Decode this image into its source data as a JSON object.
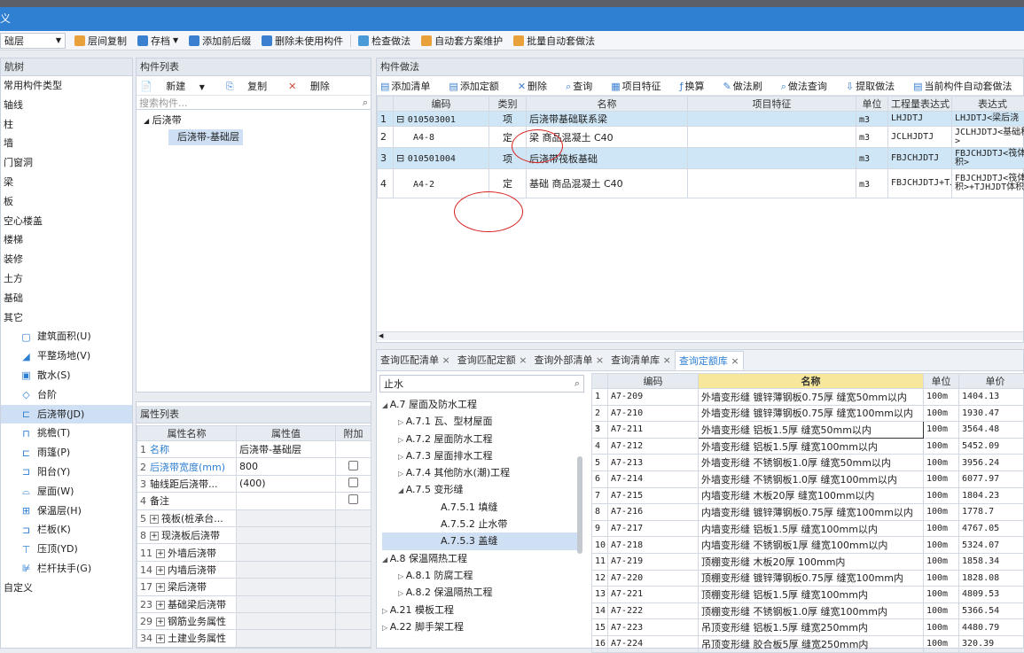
{
  "window": {
    "title": "义"
  },
  "toolbar": {
    "layer_value": "础层",
    "buttons": [
      "层间复制",
      "存档",
      "添加前后缀",
      "删除未使用构件",
      "检查做法",
      "自动套方案维护",
      "批量自动套做法"
    ]
  },
  "nav": {
    "title": "航树",
    "categories": [
      "常用构件类型",
      "轴线",
      "柱",
      "墙",
      "门窗洞",
      "梁",
      "板",
      "空心楼盖",
      "楼梯",
      "装修",
      "土方",
      "基础",
      "其它"
    ],
    "sub_items": [
      "建筑面积(U)",
      "平整场地(V)",
      "散水(S)",
      "台阶",
      "后浇带(JD)",
      "挑檐(T)",
      "雨篷(P)",
      "阳台(Y)",
      "屋面(W)",
      "保温层(H)",
      "栏板(K)",
      "压顶(YD)",
      "栏杆扶手(G)"
    ],
    "footer": "自定义"
  },
  "component_list": {
    "title": "构件列表",
    "new_label": "新建",
    "copy_label": "复制",
    "delete_label": "删除",
    "search_placeholder": "搜索构件...",
    "tree_root": "后浇带",
    "tree_child": "后浇带-基础层"
  },
  "props": {
    "title": "属性列表",
    "headers": [
      "属性名称",
      "属性值",
      "附加"
    ],
    "rows": [
      {
        "n": "1",
        "name": "名称",
        "value": "后浇带-基础层"
      },
      {
        "n": "2",
        "name": "后浇带宽度(mm)",
        "value": "800"
      },
      {
        "n": "3",
        "name": "轴线距后浇带...",
        "value": "(400)"
      },
      {
        "n": "4",
        "name": "备注",
        "value": ""
      },
      {
        "n": "5",
        "name": "筏板(桩承台...",
        "value": ""
      },
      {
        "n": "8",
        "name": "现浇板后浇带",
        "value": ""
      },
      {
        "n": "11",
        "name": "外墙后浇带",
        "value": ""
      },
      {
        "n": "14",
        "name": "内墙后浇带",
        "value": ""
      },
      {
        "n": "17",
        "name": "梁后浇带",
        "value": ""
      },
      {
        "n": "23",
        "name": "基础梁后浇带",
        "value": ""
      },
      {
        "n": "29",
        "name": "钢筋业务属性",
        "value": ""
      },
      {
        "n": "34",
        "name": "土建业务属性",
        "value": ""
      }
    ]
  },
  "method": {
    "title": "构件做法",
    "toolbar": [
      "添加清单",
      "添加定额",
      "删除",
      "查询",
      "项目特征",
      "换算",
      "做法刷",
      "做法查询",
      "提取做法",
      "当前构件自动套做法"
    ],
    "headers": [
      "编码",
      "类别",
      "名称",
      "项目特征",
      "单位",
      "工程量表达式",
      "表达式"
    ],
    "rows": [
      {
        "n": "1",
        "code": "010503001",
        "type": "项",
        "name": "后浇带基础联系梁",
        "feat": "",
        "unit": "m3",
        "expr": "LHJDTJ",
        "desc": "LHJDTJ<梁后浇"
      },
      {
        "n": "2",
        "code": "A4-8",
        "type": "定",
        "name": "梁 商品混凝土 C40",
        "feat": "",
        "unit": "m3",
        "expr": "JCLHJDTJ",
        "desc": "JCLHJDTJ<基础积>"
      },
      {
        "n": "3",
        "code": "010501004",
        "type": "项",
        "name": "后浇带筏板基础",
        "feat": "",
        "unit": "m3",
        "expr": "FBJCHJDTJ",
        "desc": "FBJCHJDTJ<筏体积>"
      },
      {
        "n": "4",
        "code": "A4-2",
        "type": "定",
        "name": "基础 商品混凝土 C40",
        "feat": "",
        "unit": "m3",
        "expr": "FBJCHJDTJ+TJHJDTJ",
        "desc": "FBJCHJDTJ<筏体积>+TJHJDT体积>"
      }
    ]
  },
  "query": {
    "tabs": [
      "查询匹配清单",
      "查询匹配定额",
      "查询外部清单",
      "查询清单库",
      "查询定额库"
    ],
    "search_value": "止水",
    "tree": [
      {
        "t": "A.7 屋面及防水工程",
        "lvl": 0,
        "arrow": "◢"
      },
      {
        "t": "A.7.1 瓦、型材屋面",
        "lvl": 1,
        "arrow": "▷"
      },
      {
        "t": "A.7.2 屋面防水工程",
        "lvl": 1,
        "arrow": "▷"
      },
      {
        "t": "A.7.3 屋面排水工程",
        "lvl": 1,
        "arrow": "▷"
      },
      {
        "t": "A.7.4 其他防水(潮)工程",
        "lvl": 1,
        "arrow": "▷"
      },
      {
        "t": "A.7.5 变形缝",
        "lvl": 1,
        "arrow": "◢"
      },
      {
        "t": "A.7.5.1 填缝",
        "lvl": 2,
        "arrow": ""
      },
      {
        "t": "A.7.5.2 止水带",
        "lvl": 2,
        "arrow": ""
      },
      {
        "t": "A.7.5.3 盖缝",
        "lvl": 2,
        "arrow": "",
        "sel": true
      },
      {
        "t": "A.8 保温隔热工程",
        "lvl": 0,
        "arrow": "◢"
      },
      {
        "t": "A.8.1 防腐工程",
        "lvl": 1,
        "arrow": "▷"
      },
      {
        "t": "A.8.2 保温隔热工程",
        "lvl": 1,
        "arrow": "▷"
      },
      {
        "t": "A.21 模板工程",
        "lvl": 0,
        "arrow": "▷"
      },
      {
        "t": "A.22 脚手架工程",
        "lvl": 0,
        "arrow": "▷"
      }
    ],
    "headers": [
      "编码",
      "名称",
      "单位",
      "单价"
    ],
    "rows": [
      [
        "1",
        "A7-209",
        "外墙变形缝 镀锌薄钢板0.75厚 缝宽50mm以内",
        "100m",
        "1404.13"
      ],
      [
        "2",
        "A7-210",
        "外墙变形缝 镀锌薄钢板0.75厚 缝宽100mm以内",
        "100m",
        "1930.47"
      ],
      [
        "3",
        "A7-211",
        "外墙变形缝 铝板1.5厚 缝宽50mm以内",
        "100m",
        "3564.48"
      ],
      [
        "4",
        "A7-212",
        "外墙变形缝 铝板1.5厚 缝宽100mm以内",
        "100m",
        "5452.09"
      ],
      [
        "5",
        "A7-213",
        "外墙变形缝 不锈钢板1.0厚 缝宽50mm以内",
        "100m",
        "3956.24"
      ],
      [
        "6",
        "A7-214",
        "外墙变形缝 不锈钢板1.0厚 缝宽100mm以内",
        "100m",
        "6077.97"
      ],
      [
        "7",
        "A7-215",
        "内墙变形缝 木板20厚 缝宽100mm以内",
        "100m",
        "1804.23"
      ],
      [
        "8",
        "A7-216",
        "内墙变形缝 镀锌薄钢板0.75厚 缝宽100mm以内",
        "100m",
        "1778.7"
      ],
      [
        "9",
        "A7-217",
        "内墙变形缝 铝板1.5厚 缝宽100mm以内",
        "100m",
        "4767.05"
      ],
      [
        "10",
        "A7-218",
        "内墙变形缝 不锈钢板1厚 缝宽100mm以内",
        "100m",
        "5324.07"
      ],
      [
        "11",
        "A7-219",
        "顶棚变形缝 木板20厚 100mm内",
        "100m",
        "1858.34"
      ],
      [
        "12",
        "A7-220",
        "顶棚变形缝 镀锌薄钢板0.75厚 缝宽100mm内",
        "100m",
        "1828.08"
      ],
      [
        "13",
        "A7-221",
        "顶棚变形缝 铝板1.5厚 缝宽100mm内",
        "100m",
        "4809.53"
      ],
      [
        "14",
        "A7-222",
        "顶棚变形缝 不锈钢板1.0厚 缝宽100mm内",
        "100m",
        "5366.54"
      ],
      [
        "15",
        "A7-223",
        "吊顶变形缝 铝板1.5厚 缝宽250mm内",
        "100m",
        "4480.79"
      ],
      [
        "16",
        "A7-224",
        "吊顶变形缝 胶合板5厚 缝宽250mm内",
        "100m",
        "320.39"
      ]
    ]
  }
}
